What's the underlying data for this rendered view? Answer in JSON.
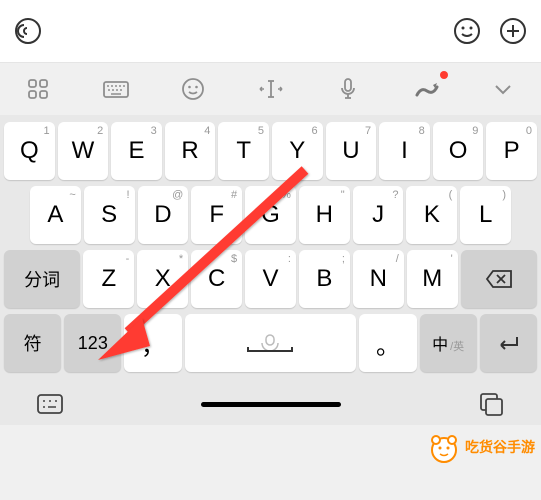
{
  "input": {
    "value": "",
    "placeholder": ""
  },
  "toolbar": {
    "icons": [
      "grid",
      "keyboard-settings",
      "emoji",
      "cursor",
      "mic",
      "gif",
      "collapse"
    ]
  },
  "keyboard": {
    "row1": [
      {
        "main": "Q",
        "sup": "1"
      },
      {
        "main": "W",
        "sup": "2"
      },
      {
        "main": "E",
        "sup": "3"
      },
      {
        "main": "R",
        "sup": "4"
      },
      {
        "main": "T",
        "sup": "5"
      },
      {
        "main": "Y",
        "sup": "6"
      },
      {
        "main": "U",
        "sup": "7"
      },
      {
        "main": "I",
        "sup": "8"
      },
      {
        "main": "O",
        "sup": "9"
      },
      {
        "main": "P",
        "sup": "0"
      }
    ],
    "row2": [
      {
        "main": "A",
        "sup": "~"
      },
      {
        "main": "S",
        "sup": "!"
      },
      {
        "main": "D",
        "sup": "@"
      },
      {
        "main": "F",
        "sup": "#"
      },
      {
        "main": "G",
        "sup": "%"
      },
      {
        "main": "H",
        "sup": "\""
      },
      {
        "main": "J",
        "sup": "?"
      },
      {
        "main": "K",
        "sup": "("
      },
      {
        "main": "L",
        "sup": ")"
      }
    ],
    "row3": {
      "split": "分词",
      "keys": [
        {
          "main": "Z",
          "sup": "-"
        },
        {
          "main": "X",
          "sup": "*"
        },
        {
          "main": "C",
          "sup": "$"
        },
        {
          "main": "V",
          "sup": ":"
        },
        {
          "main": "B",
          "sup": ";"
        },
        {
          "main": "N",
          "sup": "/"
        },
        {
          "main": "M",
          "sup": "'"
        }
      ],
      "backspace": "⌫"
    },
    "row4": {
      "symbol": "符",
      "numbers": "123",
      "comma": "，",
      "period": "。",
      "lang_main": "中",
      "lang_sub": "/英",
      "enter": "↵"
    }
  },
  "watermark": "吃货谷手游"
}
